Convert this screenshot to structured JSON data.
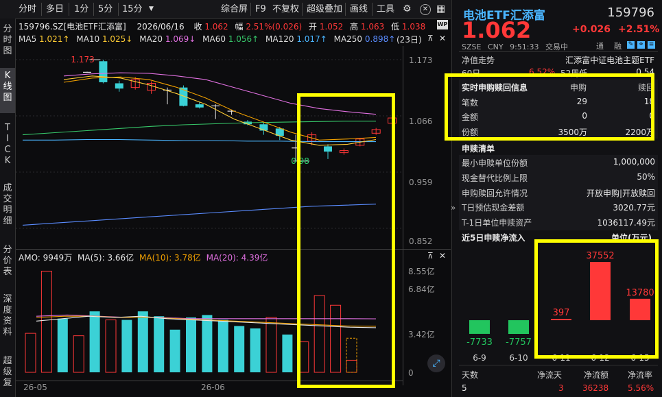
{
  "toolbar": {
    "items": [
      "分时",
      "多日",
      "1分",
      "5分",
      "15分"
    ],
    "dropdown_icon": "triangle-down-icon",
    "items_right": [
      "综合屏",
      "F9",
      "不复权",
      "超级叠加",
      "画线",
      "工具"
    ]
  },
  "vtabs": [
    {
      "label": "分时图",
      "active": false
    },
    {
      "label": "K线图",
      "active": true
    },
    {
      "label": "TICK",
      "active": false
    },
    {
      "label": "成交明细",
      "active": false
    },
    {
      "label": "分价表",
      "active": false
    },
    {
      "label": "深度资料",
      "active": false
    },
    {
      "label": "超级复",
      "active": false
    }
  ],
  "kline_info": {
    "code_name": "159796.SZ[电池ETF汇添富]",
    "date": "2026/06/16",
    "close_label": "收",
    "close": "1.062",
    "change_label": "幅",
    "change": "2.51%(0.026)",
    "open_label": "开",
    "open": "1.052",
    "high_label": "高",
    "high": "1.063",
    "low_label": "低",
    "low": "1.038"
  },
  "ma_info": [
    {
      "label": "MA5",
      "value": "1.021↑",
      "color": "#ffcc33"
    },
    {
      "label": "MA10",
      "value": "1.025↓",
      "color": "#f0a000"
    },
    {
      "label": "MA20",
      "value": "1.069↓",
      "color": "#e070e0"
    },
    {
      "label": "MA60",
      "value": "1.056↑",
      "color": "#37c86a"
    },
    {
      "label": "MA120",
      "value": "1.017↑",
      "color": "#4ab5ff"
    },
    {
      "label": "MA250",
      "value": "0.898↑",
      "color": "#5a8cff"
    }
  ],
  "period_badge": "(23日)",
  "price_axis": [
    "1.173",
    "1.066",
    "0.959",
    "0.852"
  ],
  "annotations": {
    "high": "1.173",
    "low": "0.98"
  },
  "vol_info": {
    "amo": "AMO: 9949万",
    "ma5": "MA(5): 3.66亿",
    "ma10": "MA(10): 3.78亿",
    "ma20": "MA(20): 4.39亿"
  },
  "vol_axis": [
    "8.55亿",
    "6.84亿",
    "3.42亿",
    "0"
  ],
  "date_axis": [
    "26-05",
    "26-06"
  ],
  "chart_data": {
    "type": "candlestick",
    "y_range": [
      0.852,
      1.173
    ],
    "candles": [
      {
        "o": 1.15,
        "c": 1.149,
        "h": 1.15,
        "l": 1.148,
        "dir": "flat"
      },
      {
        "o": 1.17,
        "c": 1.13,
        "h": 1.173,
        "l": 1.128,
        "dir": "down"
      },
      {
        "o": 1.128,
        "c": 1.118,
        "h": 1.133,
        "l": 1.112,
        "dir": "down"
      },
      {
        "o": 1.12,
        "c": 1.135,
        "h": 1.14,
        "l": 1.116,
        "dir": "up"
      },
      {
        "o": 1.115,
        "c": 1.128,
        "h": 1.132,
        "l": 1.108,
        "dir": "up"
      },
      {
        "o": 1.115,
        "c": 1.115,
        "h": 1.12,
        "l": 1.088,
        "dir": "flat"
      },
      {
        "o": 1.12,
        "c": 1.085,
        "h": 1.124,
        "l": 1.084,
        "dir": "down"
      },
      {
        "o": 1.088,
        "c": 1.082,
        "h": 1.092,
        "l": 1.08,
        "dir": "down"
      },
      {
        "o": 1.085,
        "c": 1.085,
        "h": 1.088,
        "l": 1.06,
        "dir": "flat"
      },
      {
        "o": 1.075,
        "c": 1.075,
        "h": 1.078,
        "l": 1.068,
        "dir": "flat"
      },
      {
        "o": 1.055,
        "c": 1.05,
        "h": 1.058,
        "l": 1.048,
        "dir": "down"
      },
      {
        "o": 1.05,
        "c": 1.038,
        "h": 1.055,
        "l": 1.03,
        "dir": "down"
      },
      {
        "o": 1.042,
        "c": 1.028,
        "h": 1.045,
        "l": 1.02,
        "dir": "down"
      },
      {
        "o": 1.005,
        "c": 1.005,
        "h": 1.03,
        "l": 0.98,
        "dir": "flat"
      },
      {
        "o": 1.018,
        "c": 1.03,
        "h": 1.035,
        "l": 1.01,
        "dir": "up"
      },
      {
        "o": 1.008,
        "c": 0.998,
        "h": 1.012,
        "l": 0.984,
        "dir": "down"
      },
      {
        "o": 0.996,
        "c": 1.0,
        "h": 1.004,
        "l": 0.992,
        "dir": "up"
      },
      {
        "o": 1.01,
        "c": 1.022,
        "h": 1.024,
        "l": 1.008,
        "dir": "up"
      },
      {
        "o": 1.033,
        "c": 1.04,
        "h": 1.043,
        "l": 1.03,
        "dir": "up"
      },
      {
        "o": 1.052,
        "c": 1.062,
        "h": 1.063,
        "l": 1.038,
        "dir": "up"
      }
    ],
    "ma_lines": {
      "ma250": [
        0.858,
        0.862,
        0.866,
        0.87,
        0.874,
        0.878,
        0.882,
        0.886,
        0.89,
        0.894,
        0.896,
        0.898
      ],
      "ma120": [
        1.02,
        1.02,
        1.021,
        1.021,
        1.02,
        1.019,
        1.019,
        1.018,
        1.018,
        1.017,
        1.017,
        1.017
      ],
      "ma60": [
        1.03,
        1.034,
        1.038,
        1.042,
        1.046,
        1.049,
        1.051,
        1.053,
        1.054,
        1.055,
        1.056,
        1.056
      ],
      "ma20": [
        1.142,
        1.146,
        1.148,
        1.147,
        1.142,
        1.135,
        1.12,
        1.105,
        1.09,
        1.08,
        1.074,
        1.069
      ],
      "ma10": [
        1.13,
        1.138,
        1.14,
        1.135,
        1.12,
        1.1,
        1.075,
        1.055,
        1.035,
        1.02,
        1.022,
        1.025
      ],
      "ma5": [
        1.135,
        1.142,
        1.138,
        1.125,
        1.108,
        1.088,
        1.06,
        1.04,
        1.02,
        1.01,
        1.012,
        1.021
      ]
    },
    "volume": {
      "y_max": 8.55,
      "bars": [
        {
          "v": 3.2,
          "dir": "up"
        },
        {
          "v": 8.3,
          "dir": "up"
        },
        {
          "v": 4.4,
          "dir": "down"
        },
        {
          "v": 3.0,
          "dir": "up"
        },
        {
          "v": 5.0,
          "dir": "down"
        },
        {
          "v": 4.3,
          "dir": "up"
        },
        {
          "v": 4.3,
          "dir": "down"
        },
        {
          "v": 5.0,
          "dir": "down"
        },
        {
          "v": 4.6,
          "dir": "down"
        },
        {
          "v": 3.5,
          "dir": "down"
        },
        {
          "v": 4.5,
          "dir": "down"
        },
        {
          "v": 4.7,
          "dir": "down"
        },
        {
          "v": 4.3,
          "dir": "down"
        },
        {
          "v": 3.8,
          "dir": "down"
        },
        {
          "v": 3.6,
          "dir": "down"
        },
        {
          "v": 4.5,
          "dir": "up"
        },
        {
          "v": 3.1,
          "dir": "down"
        },
        {
          "v": 2.5,
          "dir": "up"
        },
        {
          "v": 6.3,
          "dir": "up"
        },
        {
          "v": 5.5,
          "dir": "up"
        },
        {
          "v": 0.99,
          "dir": "up"
        }
      ],
      "ma5": [
        4.2,
        4.4,
        4.6,
        4.5,
        4.6,
        4.4,
        4.3,
        4.2,
        4.1,
        4.0,
        3.9,
        3.8,
        3.7,
        3.66
      ],
      "ma10": [
        4.5,
        4.6,
        4.6,
        4.5,
        4.5,
        4.4,
        4.3,
        4.2,
        4.1,
        4.0,
        3.9,
        3.8,
        3.78
      ],
      "ma20": [
        4.6,
        4.7,
        4.6,
        4.5,
        4.5,
        4.4,
        4.4,
        4.4,
        4.4,
        4.4,
        4.4,
        4.39
      ]
    }
  },
  "quote": {
    "name": "电池ETF汇添富",
    "code": "159796",
    "price": "1.062",
    "change": "+0.026",
    "change_pct": "+2.51%",
    "exchange": "SZSE",
    "currency": "CNY",
    "time": "9:51:33",
    "status": "交易中",
    "tag1": "通",
    "tag2": "融"
  },
  "right": {
    "nav_label": "净值走势",
    "nav_name": "汇添富中证电池主题ETF",
    "row60": {
      "label": "60日",
      "pct": "6.52%",
      "wk_label": "52周低",
      "wk_val": "0.54"
    },
    "sub_header": {
      "title": "实时申购赎回信息",
      "col1": "申购",
      "col2": "赎回"
    },
    "sub_rows": [
      {
        "label": "笔数",
        "v1": "29",
        "v2": "18"
      },
      {
        "label": "金额",
        "v1": "0",
        "v2": "0"
      },
      {
        "label": "份额",
        "v1": "3500万",
        "v2": "2200万"
      }
    ],
    "list_title": "申赎清单",
    "list_rows": [
      {
        "label": "最小申赎单位份额",
        "value": "1,000,000"
      },
      {
        "label": "现金替代比例上限",
        "value": "50%"
      },
      {
        "label": "申购赎回允许情况",
        "value": "开放申购|开放赎回"
      },
      {
        "label": "T日预估现金差额",
        "value": "3020.77元"
      },
      {
        "label": "T-1日单位申赎资产",
        "value": "1036117.49元"
      }
    ],
    "flow_title": "近5日申赎净流入",
    "flow_unit": "单位(万元)",
    "flow_chart": {
      "type": "bar",
      "categories": [
        "6-9",
        "6-10",
        "6-11",
        "6-12",
        "6-15"
      ],
      "values": [
        -7733,
        -7757,
        397,
        37552,
        13780
      ],
      "labels": [
        "-7733",
        "-7757",
        "397",
        "37552",
        "13780"
      ]
    },
    "summary_headers": [
      "天数",
      "净流天",
      "净流额",
      "净流率"
    ],
    "summary_values": [
      "5",
      "3",
      "36238",
      "5.56%"
    ]
  }
}
